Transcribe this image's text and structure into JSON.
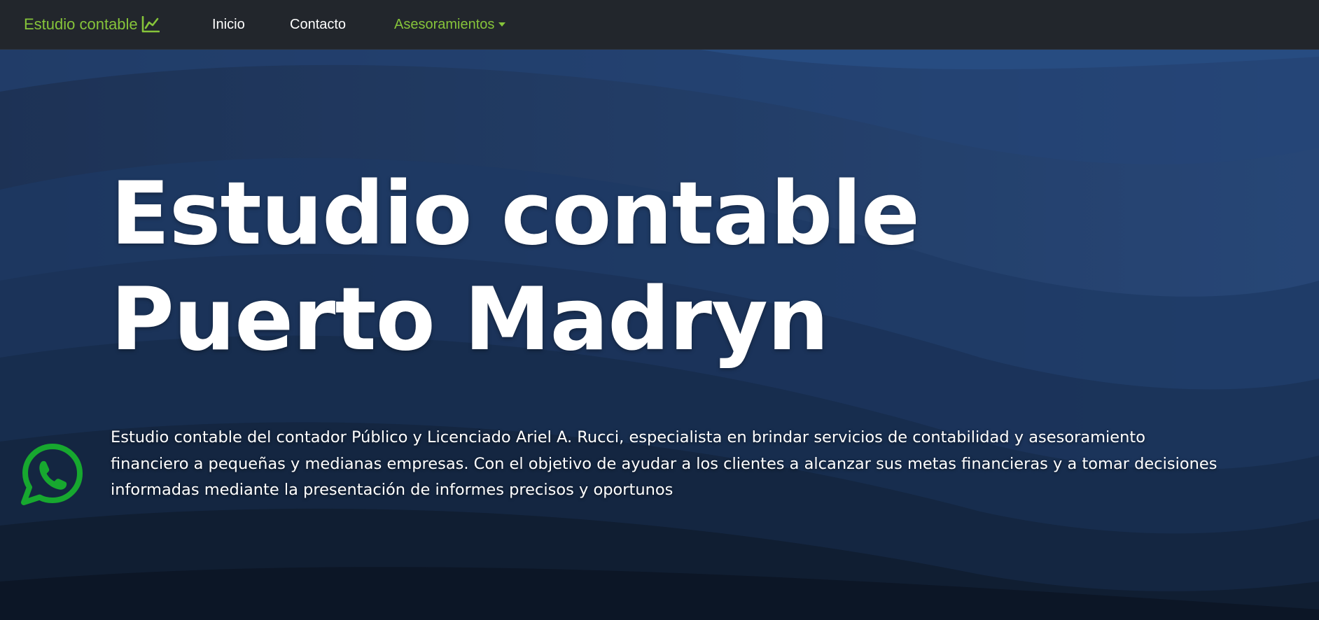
{
  "navbar": {
    "brand_label": "Estudio contable",
    "brand_icon": "line-chart-icon",
    "items": [
      {
        "label": "Inicio"
      },
      {
        "label": "Contacto"
      },
      {
        "label": "Asesoramientos"
      }
    ]
  },
  "hero": {
    "title_line1": "Estudio contable",
    "title_line2": "Puerto Madryn",
    "description": "Estudio contable del contador Público y Licenciado Ariel A. Rucci, especialista en brindar servicios de contabilidad y asesoramiento financiero a pequeñas y medianas empresas. Con el objetivo de ayudar a los clientes a alcanzar sus metas financieras y a tomar decisiones informadas mediante la presentación de informes precisos y oportunos"
  },
  "floating": {
    "whatsapp_icon": "whatsapp-icon"
  },
  "colors": {
    "accent": "#86c43a",
    "navbar_bg": "#22262c",
    "whatsapp": "#17a82f"
  }
}
